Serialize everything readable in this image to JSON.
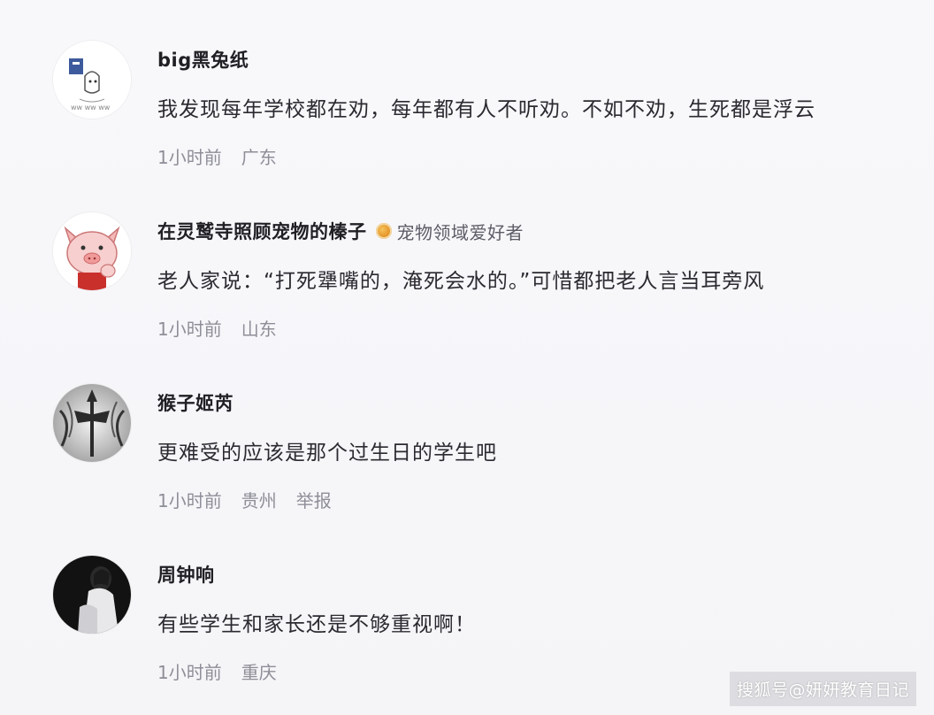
{
  "comments": [
    {
      "username": "big黑兔纸",
      "badge": "",
      "text": "我发现每年学校都在劝，每年都有人不听劝。不如不劝，生死都是浮云",
      "time": "1小时前",
      "location": "广东",
      "action": ""
    },
    {
      "username": "在灵鹫寺照顾宠物的榛子",
      "badge": "宠物领域爱好者",
      "text": "老人家说：“打死犟嘴的，淹死会水的。”可惜都把老人言当耳旁风",
      "time": "1小时前",
      "location": "山东",
      "action": ""
    },
    {
      "username": "猴子姬芮",
      "badge": "",
      "text": "更难受的应该是那个过生日的学生吧",
      "time": "1小时前",
      "location": "贵州",
      "action": "举报"
    },
    {
      "username": "周钟响",
      "badge": "",
      "text": "有些学生和家长还是不够重视啊！",
      "time": "1小时前",
      "location": "重庆",
      "action": ""
    }
  ],
  "watermark": "搜狐号@妍妍教育日记",
  "colors": {
    "background": "#f7f7fa",
    "username": "#1f1f24",
    "text": "#2a2a30",
    "meta": "#8e8e98",
    "badge_icon": "#e08a1e"
  },
  "icons": {
    "badge": "medal-icon"
  }
}
